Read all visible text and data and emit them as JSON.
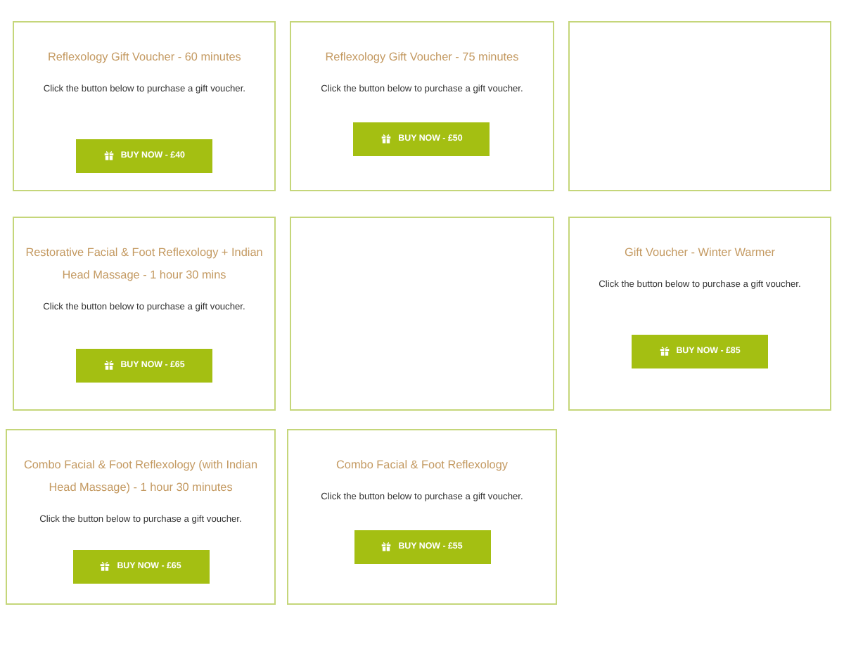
{
  "rows": [
    {
      "cards": [
        {
          "kind": "voucher",
          "title": "Reflexology Gift Voucher - 60 minutes",
          "text": "Click the button below to purchase a gift voucher.",
          "button": "BUY NOW - £40"
        },
        {
          "kind": "voucher",
          "title": "Reflexology Gift Voucher - 75 minutes",
          "text": "Click the button below to purchase a gift voucher.",
          "button": "BUY NOW - £50"
        },
        {
          "kind": "empty"
        }
      ]
    },
    {
      "cards": [
        {
          "kind": "voucher",
          "title": "Restorative Facial & Foot Reflexology + Indian Head Massage - 1 hour 30 mins",
          "text": "Click the button below to purchase a gift voucher.",
          "button": "BUY NOW - £65"
        },
        {
          "kind": "empty"
        },
        {
          "kind": "voucher",
          "title": "Gift Voucher - Winter Warmer",
          "text": "Click the button below to purchase a gift voucher.",
          "button": "BUY NOW - £85"
        }
      ]
    },
    {
      "cards": [
        {
          "kind": "voucher",
          "title": "Combo Facial & Foot Reflexology (with Indian Head Massage) - 1 hour 30 minutes",
          "text": "Click the button below to purchase a gift voucher.",
          "button": "BUY NOW - £65"
        },
        {
          "kind": "voucher",
          "title": "Combo Facial & Foot Reflexology",
          "text": "Click the button below to purchase a gift voucher.",
          "button": "BUY NOW - £55"
        }
      ]
    }
  ]
}
